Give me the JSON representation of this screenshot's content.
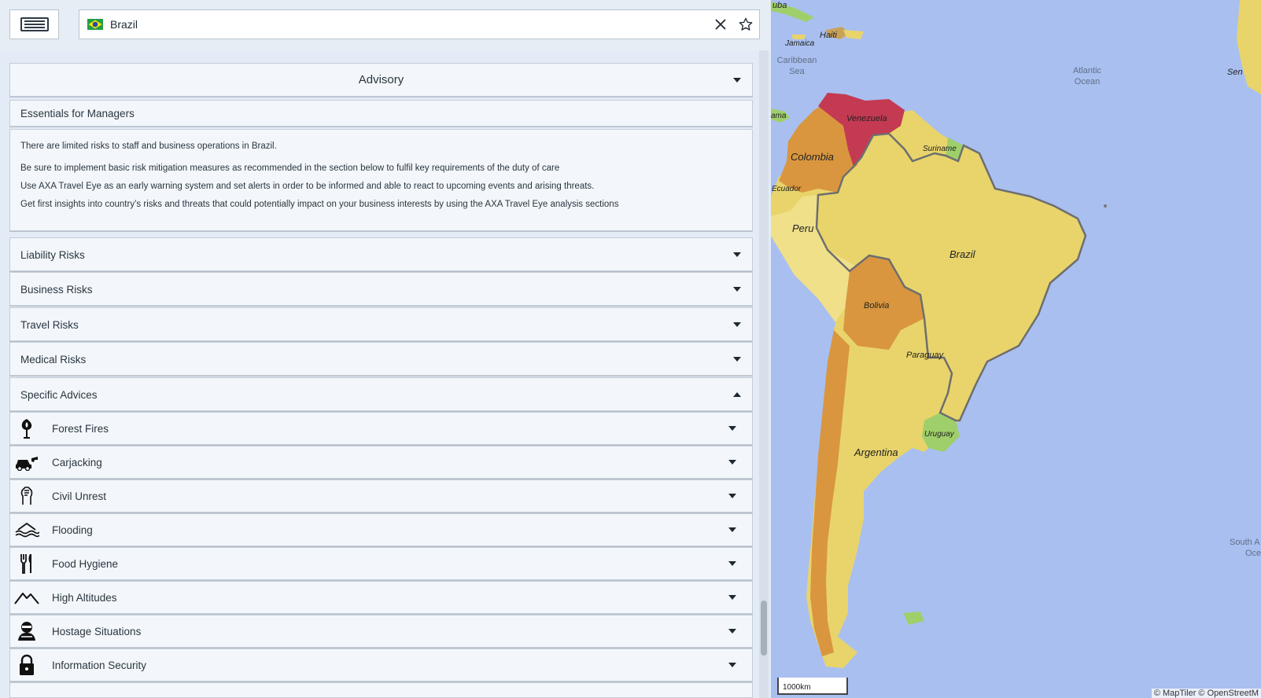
{
  "search": {
    "value": "Brazil"
  },
  "advisory": {
    "label": "Advisory"
  },
  "essentials": {
    "title": "Essentials for Managers",
    "paragraphs": [
      "There are limited risks to staff and business operations in Brazil.",
      "Be sure to implement basic risk mitigation measures as recommended in the section below to fulfil key requirements of the duty of care",
      "Use AXA Travel Eye as an early warning system and set alerts in order to be informed and able to react to upcoming events and arising threats.",
      "Get first insights into country’s risks and threats that could potentially impact on your business interests by using the AXA Travel Eye analysis sections"
    ]
  },
  "sections": [
    {
      "label": "Liability Risks"
    },
    {
      "label": "Business Risks"
    },
    {
      "label": "Travel Risks"
    },
    {
      "label": "Medical Risks"
    },
    {
      "label": "Specific Advices"
    }
  ],
  "advices": [
    {
      "label": "Forest Fires",
      "icon": "forest-fire-icon"
    },
    {
      "label": "Carjacking",
      "icon": "carjacking-icon"
    },
    {
      "label": "Civil Unrest",
      "icon": "civil-unrest-icon"
    },
    {
      "label": "Flooding",
      "icon": "flooding-icon"
    },
    {
      "label": "Food Hygiene",
      "icon": "food-hygiene-icon"
    },
    {
      "label": "High Altitudes",
      "icon": "high-altitudes-icon"
    },
    {
      "label": "Hostage Situations",
      "icon": "hostage-icon"
    },
    {
      "label": "Information Security",
      "icon": "padlock-icon"
    }
  ],
  "map": {
    "labels": {
      "cuba": "uba",
      "haiti": "Haiti",
      "jamaica": "Jamaica",
      "caribbean_1": "Caribbean",
      "caribbean_2": "Sea",
      "atlantic_1": "Atlantic",
      "atlantic_2": "Ocean",
      "venezuela": "Venezuela",
      "colombia": "Colombia",
      "ecuador": "Ecuador",
      "suriname": "Suriname",
      "peru": "Peru",
      "brazil": "Brazil",
      "bolivia": "Bolivia",
      "paraguay": "Paraguay",
      "uruguay": "Uruguay",
      "argentina": "Argentina",
      "panama": "ama",
      "senegal": "Sen",
      "south_atlantic_1": "South A",
      "south_atlantic_2": "Oce"
    },
    "scale": "1000km",
    "attribution": "© MapTiler © OpenStreetM"
  },
  "colors": {
    "ocean": "#a9bff0",
    "low_risk": "#e8d46b",
    "medium_risk": "#d9963f",
    "high_risk": "#c43a52",
    "insignificant": "#9fcf6a"
  }
}
